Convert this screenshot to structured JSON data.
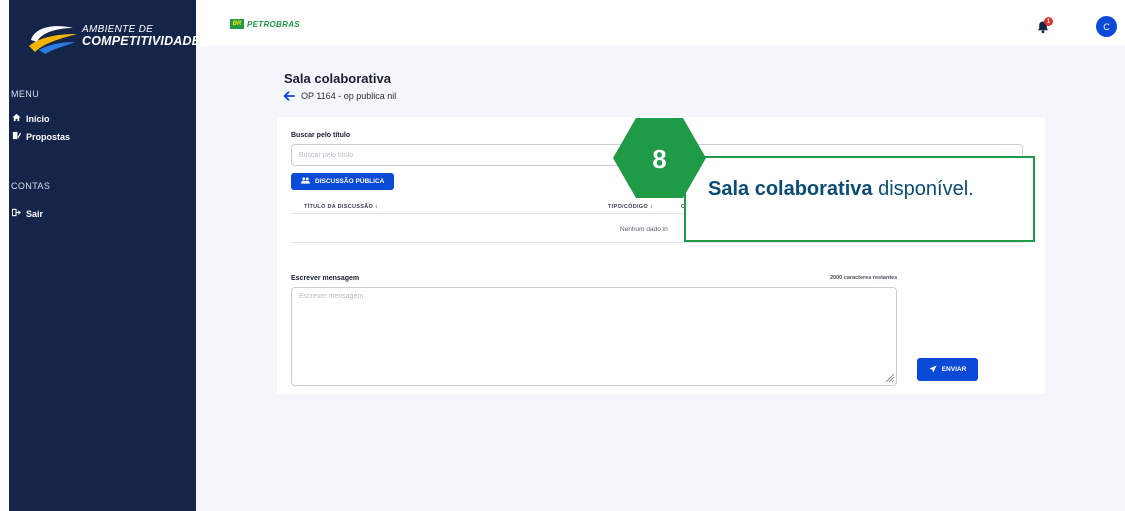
{
  "sidebar": {
    "logo_line1": "AMBIENTE DE",
    "logo_line2": "COMPETITIVIDADE",
    "menu_title": "MENU",
    "menu_items": [
      {
        "label": "Início",
        "icon": "home-icon"
      },
      {
        "label": "Propostas",
        "icon": "proposals-icon"
      }
    ],
    "accounts_title": "CONTAS",
    "accounts_items": [
      {
        "label": "Sair",
        "icon": "logout-icon"
      }
    ]
  },
  "topbar": {
    "brand_box": "BR",
    "brand_name": "PETROBRAS",
    "notification_count": "1",
    "avatar_initial": "C"
  },
  "page": {
    "title": "Sala colaborativa",
    "subtitle": "OP 1164 - op publica nil"
  },
  "search": {
    "label": "Buscar pelo título",
    "placeholder": "Buscar pelo título"
  },
  "public_discussion_button": "DISCUSSÃO PÚBLICA",
  "table": {
    "headers": [
      "TÍTULO DA DISCUSSÃO ↕",
      "TIPO/CÓDIGO ↕",
      "C"
    ],
    "empty_message": "Nenhum dado in"
  },
  "message": {
    "label": "Escrever mensagem",
    "remaining": "2000 caracteres restantes",
    "placeholder": "Escrever mensagem"
  },
  "send_button": "ENVIAR",
  "tutorial": {
    "step": "8",
    "highlight": "Sala colaborativa",
    "rest": " disponível."
  },
  "colors": {
    "sidebar_bg": "#15254a",
    "primary": "#0b49d7",
    "tutorial_green": "#1f9a46",
    "tutorial_text": "#0b4c74"
  }
}
